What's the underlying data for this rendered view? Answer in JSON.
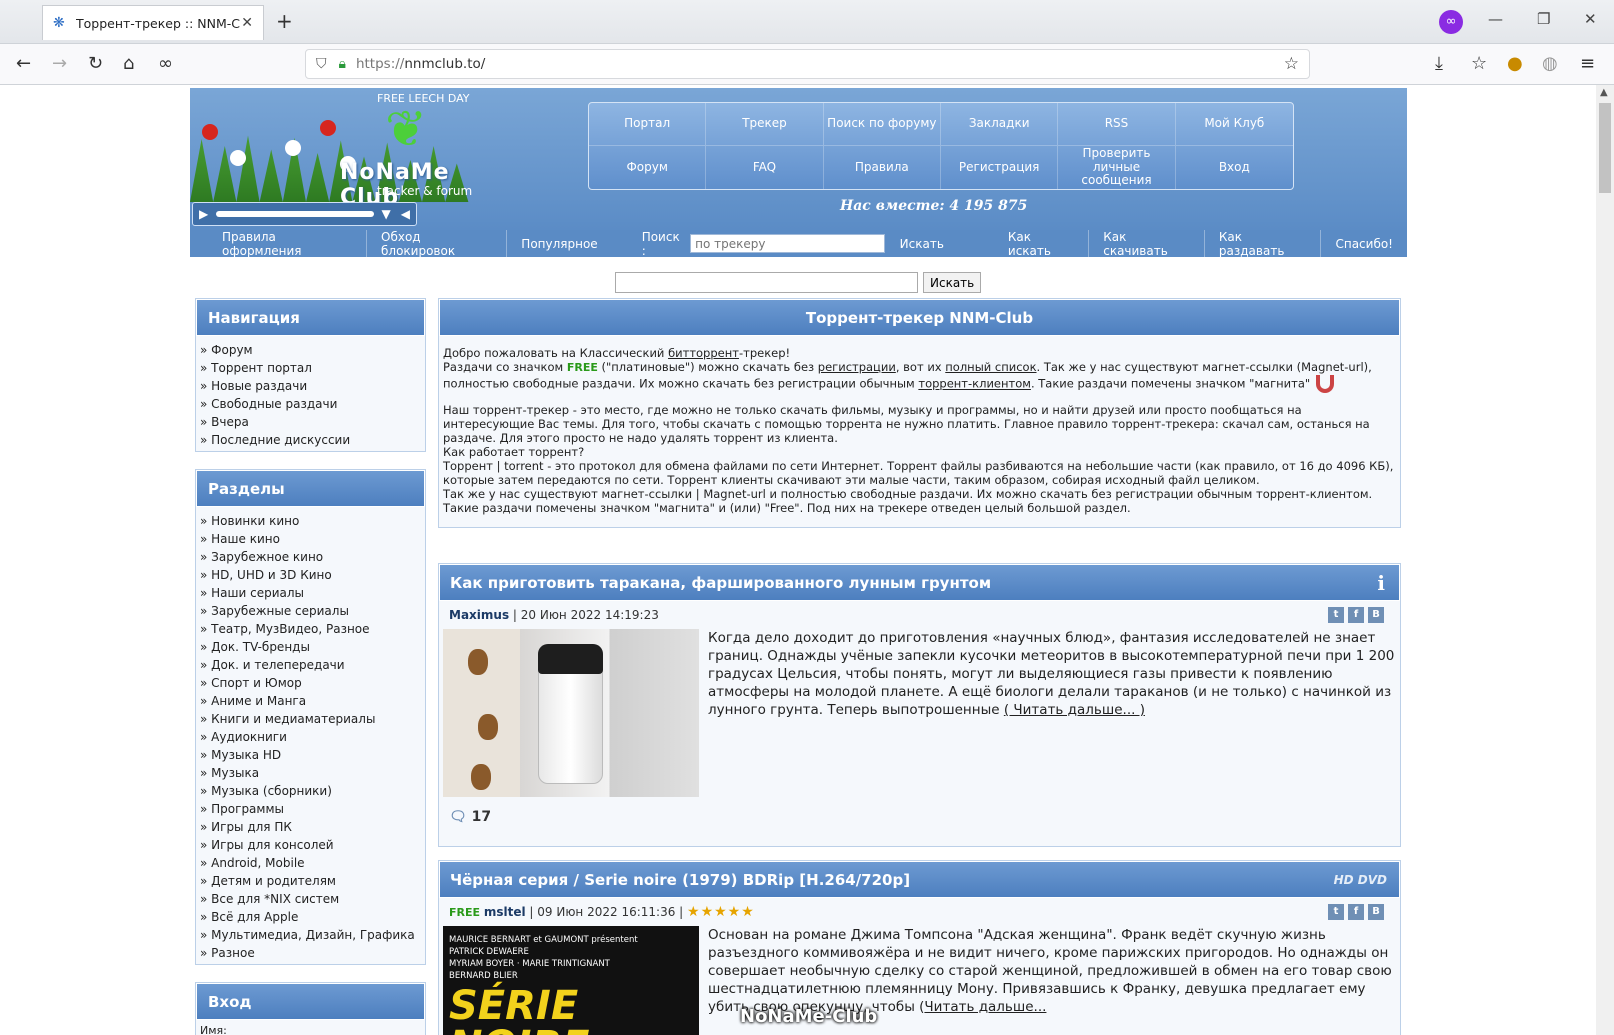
{
  "browser": {
    "tab_title": "Торрент-трекер :: NNM-Club",
    "url_scheme": "https://",
    "url_host": "nnmclub.to/"
  },
  "header": {
    "free_leech": "FREE LEECH DAY",
    "site_name": "NoNaMe Club",
    "site_sub": "tracker & forum",
    "together": "Нас вместе: 4 195 875",
    "menu": [
      "Портал",
      "Трекер",
      "Поиск по форуму",
      "Закладки",
      "RSS",
      "Мой Клуб",
      "Форум",
      "FAQ",
      "Правила",
      "Регистрация",
      "Проверить личные сообщения",
      "Вход"
    ],
    "subnav": [
      "Правила оформления",
      "Обход блокировок",
      "Популярное"
    ],
    "search_label": "Поиск :",
    "search_placeholder": "по трекеру",
    "search_button": "Искать",
    "subnav_right": [
      "Как искать",
      "Как скачивать",
      "Как раздавать",
      "Спасибо!"
    ]
  },
  "global_search": {
    "button": "Искать"
  },
  "sidebar": {
    "nav_title": "Навигация",
    "nav_items": [
      "Форум",
      "Торрент портал",
      "Новые раздачи",
      "Свободные раздачи",
      "Вчера",
      "Последние дискуссии"
    ],
    "sections_title": "Разделы",
    "sections_items": [
      "Новинки кино",
      "Наше кино",
      "Зарубежное кино",
      "HD, UHD и 3D Кино",
      "Наши сериалы",
      "Зарубежные сериалы",
      "Театр, МузВидео, Разное",
      "Док. TV-бренды",
      "Док. и телепередачи",
      "Спорт и Юмор",
      "Аниме и Манга",
      "Книги и медиаматериалы",
      "Аудиокниги",
      "Музыка HD",
      "Музыка",
      "Музыка (сборники)",
      "Программы",
      "Игры для ПК",
      "Игры для консолей",
      "Android, Mobile",
      "Детям и родителям",
      "Все для *NIX систем",
      "Всё для Apple",
      "Мультимедиа, Дизайн, Графика",
      "Разное"
    ],
    "login_title": "Вход",
    "login_label": "Имя:"
  },
  "main": {
    "title": "Торрент-трекер NNM-Club",
    "intro": {
      "l1a": "Добро пожаловать на Классический ",
      "l1link": "битторрент",
      "l1b": "-трекер!",
      "l2a": "Раздачи со значком ",
      "free": "FREE",
      "l2b": " (\"платиновые\") можно скачать без ",
      "l2link1": "регистрации",
      "l2c": ", вот их ",
      "l2link2": "полный список",
      "l2d": ". Так же у нас существуют магнет-ссылки (Magnet-url), полностью свободные раздачи. Их можно скачать без регистрации обычным ",
      "l2link3": "торрент-клиентом",
      "l2e": ". Такие раздачи помечены значком \"магнита\"",
      "p2": "Наш торрент-трекер - это место, где можно не только скачать фильмы, музыку и программы, но и найти друзей или просто пообщаться на интересующие Вас темы. Для того, чтобы скачать с помощью торрента не нужно платить. Главное правило торрент-трекера: скачал сам, останься на раздаче. Для этого просто не надо удалять торрент из клиента.",
      "p3": "Как работает торрент?",
      "p4": "Торрент | torrent - это протокол для обмена файлами по сети Интернет. Торрент файлы разбиваются на небольшие части (как правило, от 16 до 4096 КБ), которые затем передаются по сети. Торрент клиенты скачивают эти малые части, таким образом, собирая исходный файл целиком.",
      "p5": "Так же у нас существуют магнет-ссылки | Magnet-url и полностью свободные раздачи. Их можно скачать без регистрации обычным торрент-клиентом. Такие раздачи помечены значком \"магнита\" и (или) \"Free\". Под них на трекере отведен целый большой раздел."
    }
  },
  "news1": {
    "title": "Как приготовить таракана, фаршированного лунным грунтом",
    "author": "Maximus",
    "date": " | 20 Июн 2022 14:19:23",
    "text": "Когда дело доходит до приготовления «научных блюд», фантазия исследователей не знает границ. Однажды учёные запекли кусочки метеоритов в высокотемпературной печи при 1 200 градусах Цельсия, чтобы понять, могут ли выделяющиеся газы привести к появлению атмосферы на молодой планете. А ещё биологи делали тараканов (и не только) с начинкой из лунного грунта. Теперь выпотрошенные ",
    "more": "( Читать дальше... )",
    "comments": "17"
  },
  "news2": {
    "title": "Чёрная серия / Serie noire (1979) BDRip [H.264/720p]",
    "badge": "HD DVD",
    "free": "FREE",
    "author": "msltel",
    "date": " | 09 Июн 2022 16:11:36 | ",
    "stars": "★★★★★",
    "text": "Основан на романе Джима Томпсона \"Адская женщина\". Франк ведёт скучную жизнь разъездного коммивояжёра и не видит ничего, кроме парижских пригородов. Но однажды он совершает необычную сделку со старой женщиной, предложившей в обмен на его товар свою шестнадцатилетнюю племянницу Мону. Привязавшись к Франку, девушка предлагает ему убить свою опекуншу, чтобы (",
    "more": "Читать дальше...",
    "poster_credits": "MAURICE BERNART et GAUMONT présentent\nPATRICK DEWAERE\nMYRIAM BOYER · MARIE TRINTIGNANT\nBERNARD BLIER",
    "poster_title": "SÉRIE NOIRE"
  },
  "watermark": "NoNaMe-Club"
}
